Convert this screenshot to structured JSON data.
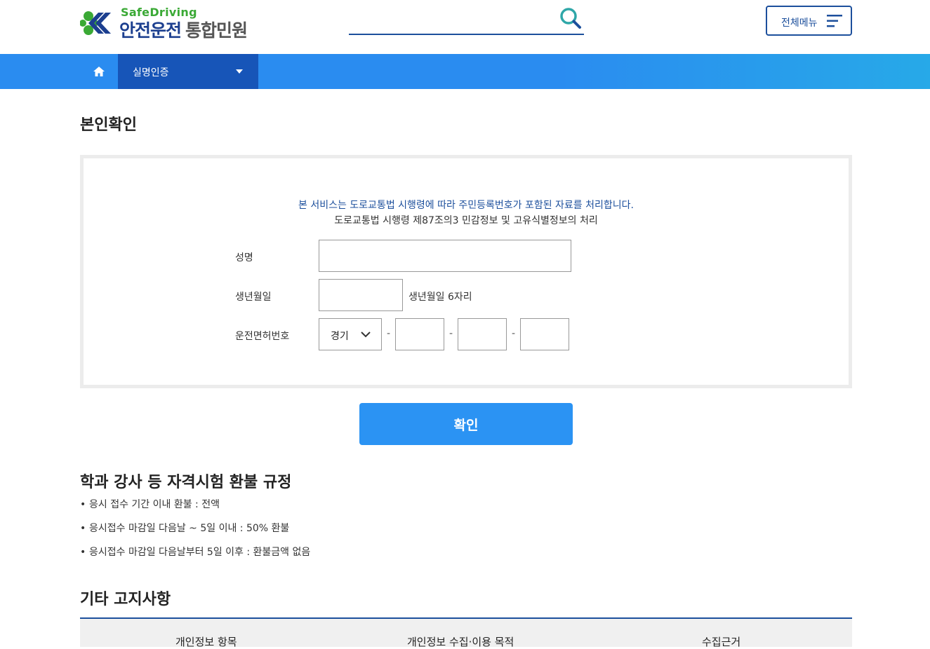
{
  "header": {
    "logo_en": "SafeDriving",
    "logo_ko_main": "안전운전",
    "logo_ko_sub": "통합민원",
    "search_placeholder": "",
    "all_menu_label": "전체메뉴"
  },
  "nav": {
    "home_icon": "home-icon",
    "dropdown_label": "실명인증"
  },
  "page": {
    "title": "본인확인"
  },
  "form": {
    "notice_line1": "본 서비스는 도로교통법 시행령에 따라 주민등록번호가 포함된 자료를 처리합니다.",
    "notice_line2": "도로교통법 시행령 제87조의3 민감정보 및 고유식별정보의 처리",
    "name_label": "성명",
    "name_value": "",
    "birth_label": "생년월일",
    "birth_value": "",
    "birth_hint": "생년월일 6자리",
    "license_label": "운전면허번호",
    "license_region": "경기",
    "license_part2": "",
    "license_part3": "",
    "license_part4": "",
    "dash": "-"
  },
  "confirm_label": "확인",
  "refund": {
    "title": "학과 강사 등 자격시험 환불 규정",
    "items": [
      "응시 접수 기간 이내 환불 : 전액",
      "응시접수 마감일 다음날 ~ 5일 이내 : 50% 환불",
      "응시접수 마감일 다음날부터 5일 이후 : 환불금액 없음"
    ]
  },
  "other": {
    "title": "기타 고지사항",
    "columns": [
      "개인정보 항목",
      "개인정보 수집·이용 목적",
      "수집근거"
    ]
  },
  "colors": {
    "brand_blue": "#1c4f9c",
    "nav_blue": "#2a8cf0",
    "nav_active": "#1755b8",
    "button_blue": "#2b93f3",
    "logo_green": "#3aa935"
  }
}
